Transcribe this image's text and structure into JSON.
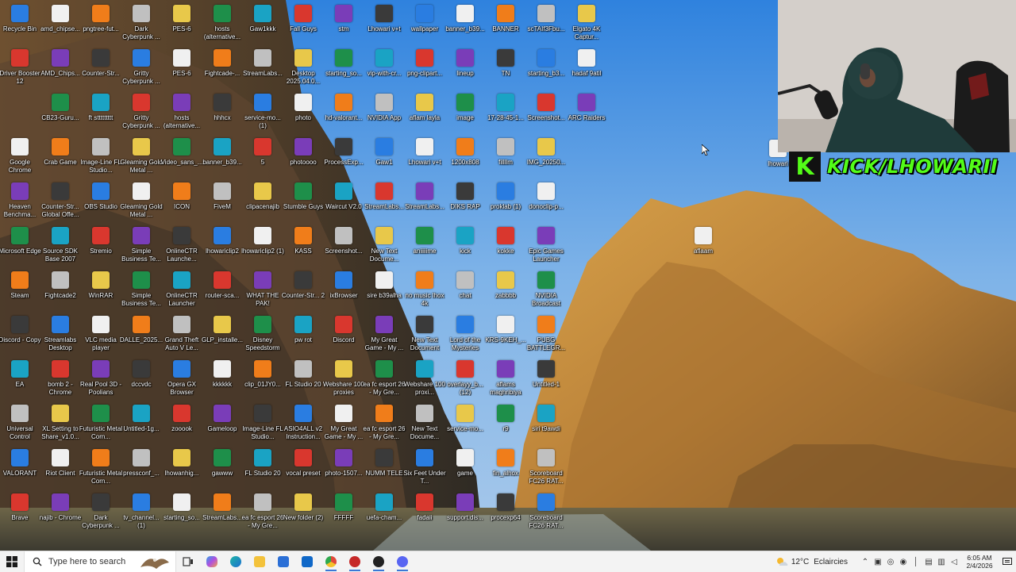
{
  "desktop": {
    "columns": [
      [
        "Recycle Bin",
        "Driver Booster 12",
        "",
        "Google Chrome",
        "Heaven Benchma...",
        "Microsoft Edge",
        "Steam",
        "Discord - Copy",
        "EA",
        "Universal Control",
        "VALORANT",
        "Brave"
      ],
      [
        "amd_chipse...",
        "AMD_Chips...",
        "CB23-Guru...",
        "Crab Game",
        "Counter-Str... Global Offe...",
        "Source SDK Base 2007",
        "Fightcade2",
        "Streamlabs Desktop",
        "bomb 2 - Chrome",
        "XL Setting to Share_v1.0...",
        "Riot Client",
        "najib - Chrome"
      ],
      [
        "pngtree-fut...",
        "Counter-Str...",
        "ft sttttttttt",
        "Image-Line FL Studio...",
        "OBS Studio",
        "Stremio",
        "WinRAR",
        "VLC media player",
        "Real Pool 3D - Poolians",
        "Futuristic Metal Corn...",
        "Futuristic Metal Corn...",
        "Dark Cyberpunk ..."
      ],
      [
        "Dark Cyberpunk ...",
        "Gritty Cyberpunk ...",
        "Gritty Cyberpunk ...",
        "Gleaming Gold Metal ...",
        "Gleaming Gold Metal ...",
        "Simple Business Te...",
        "Simple Business Te...",
        "DALLE_2025...",
        "dccvdc",
        "Untitled-1g...",
        "pressconf_...",
        "tv_channel... (1)"
      ],
      [
        "PES-6",
        "PES-6",
        "hosts (alternative...",
        "Video_sans_...",
        "ICON",
        "OnlineCTR Launche...",
        "OnlineCTR Launcher",
        "Grand Theft Auto V Le...",
        "Opera GX Browser",
        "zooook",
        "lhowanhig...",
        "starting_so..."
      ],
      [
        "hosts (alternative...",
        "Fightcade-...",
        "hhhcx",
        "banner_b39...",
        "FiveM",
        "lhowariclip2",
        "router-sca...",
        "GLP_installe...",
        "kkkkkk",
        "Gameloop",
        "gawww",
        "StreamLabs..."
      ],
      [
        "Gaw1kkk",
        "StreamLabs...",
        "service-mo... (1)",
        "5",
        "clipacenajib",
        "lhowariclip2 (1)",
        "WHAT THE PAK!",
        "Disney Speedstorm",
        "clip_01JY0...",
        "Image-Line FL Studio...",
        "FL Studio 20",
        "ea fc esport 26 - My Gre..."
      ],
      [
        "Fall Guys",
        "Desktop 2025.04.0...",
        "photo",
        "photoooo",
        "Stumble Guys",
        "KASS",
        "Counter-Str... 2",
        "pw rot",
        "FL Studio 20",
        "ASIO4ALL v2 Instruction...",
        "vocal preset",
        "New folder (2)"
      ],
      [
        "stm",
        "starting_so...",
        "hd-valorant...",
        "ProcessExp...",
        "Waircut V2.0",
        "Screenshot...",
        "ixBrowser",
        "Discord",
        "Webshare 100 proxies",
        "My Great Game - My ...",
        "photo-1507...",
        "FFFFF"
      ],
      [
        "Lhowari v+t",
        "vip-with-cr...",
        "NVIDIA App",
        "Gaw1",
        "StreamLabs...",
        "New Text Docume...",
        "sire b39alha",
        "My Great Game - My ...",
        "ea fc esport 26 - My Gre...",
        "ea fc esport 26 - My Gre...",
        "NUMM TELE",
        "uefa-cham..."
      ],
      [
        "wallpaper",
        "png-clipart...",
        "aflam layla",
        "Lhowari v+t",
        "StreamLabs...",
        "aniiiiime",
        "no music lhox 4k",
        "New Text Document",
        "Webshare 100 proxi...",
        "New Text Docume...",
        "Six Feet Under T...",
        "fadaii"
      ],
      [
        "banner_b39...",
        "lineup",
        "image",
        "1200x808",
        "DIKS RAP",
        "kick",
        "chat",
        "Lord of the Mysteries",
        "overlayy_b... (12)",
        "service-mo...",
        "game",
        "support.dis..."
      ],
      [
        "BANNER",
        "TN",
        "17-28-45-1...",
        "fillllm",
        "proklab (1)",
        "kokke",
        "zabbbb",
        "KRS-9KEH_...",
        "aflams maghribiya",
        "r9",
        "fin_alhox",
        "procexp64"
      ],
      [
        "scTAIf3Fbu...",
        "starting_b3...",
        "Screenshot...",
        "IMG_20250...",
        "donoclip-p...",
        "Epic Games Launcher",
        "NVIDIA Broadcast",
        "PUBG BATTLEGR...",
        "Untitled-1",
        "siri t9awdi",
        "Scoreboard FC26 RAT...",
        "Scoreboard FC26 RAT..."
      ],
      [
        "Elgato 4K Captur...",
        "hadaf 9atil",
        "ARC Raiders",
        "",
        "",
        "",
        "",
        "",
        "",
        "",
        "",
        ""
      ]
    ],
    "extra_icons": [
      {
        "label": "aflaam"
      },
      {
        "label": "lhowari"
      }
    ],
    "icon_colors": [
      "#2a7de1",
      "#d9372e",
      "#e8c84a",
      "#f0f0f0",
      "#7a3db8",
      "#1e8f4a",
      "#f07d1a",
      "#3a3a3a",
      "#1aa3c4",
      "#c0c0c0"
    ]
  },
  "overlay": {
    "kick_logo": "K",
    "kick_text": "KICK/LHOWARII"
  },
  "taskbar": {
    "search_placeholder": "Type here to search",
    "apps": [
      "task-view",
      "copilot",
      "edge",
      "file-explorer",
      "store",
      "outlook",
      "chrome",
      "app-red",
      "app-dark",
      "discord"
    ],
    "weather_temp": "12°C",
    "weather_desc": "Eclaircies",
    "time": "6:05 AM",
    "date": "2/4/2026"
  }
}
